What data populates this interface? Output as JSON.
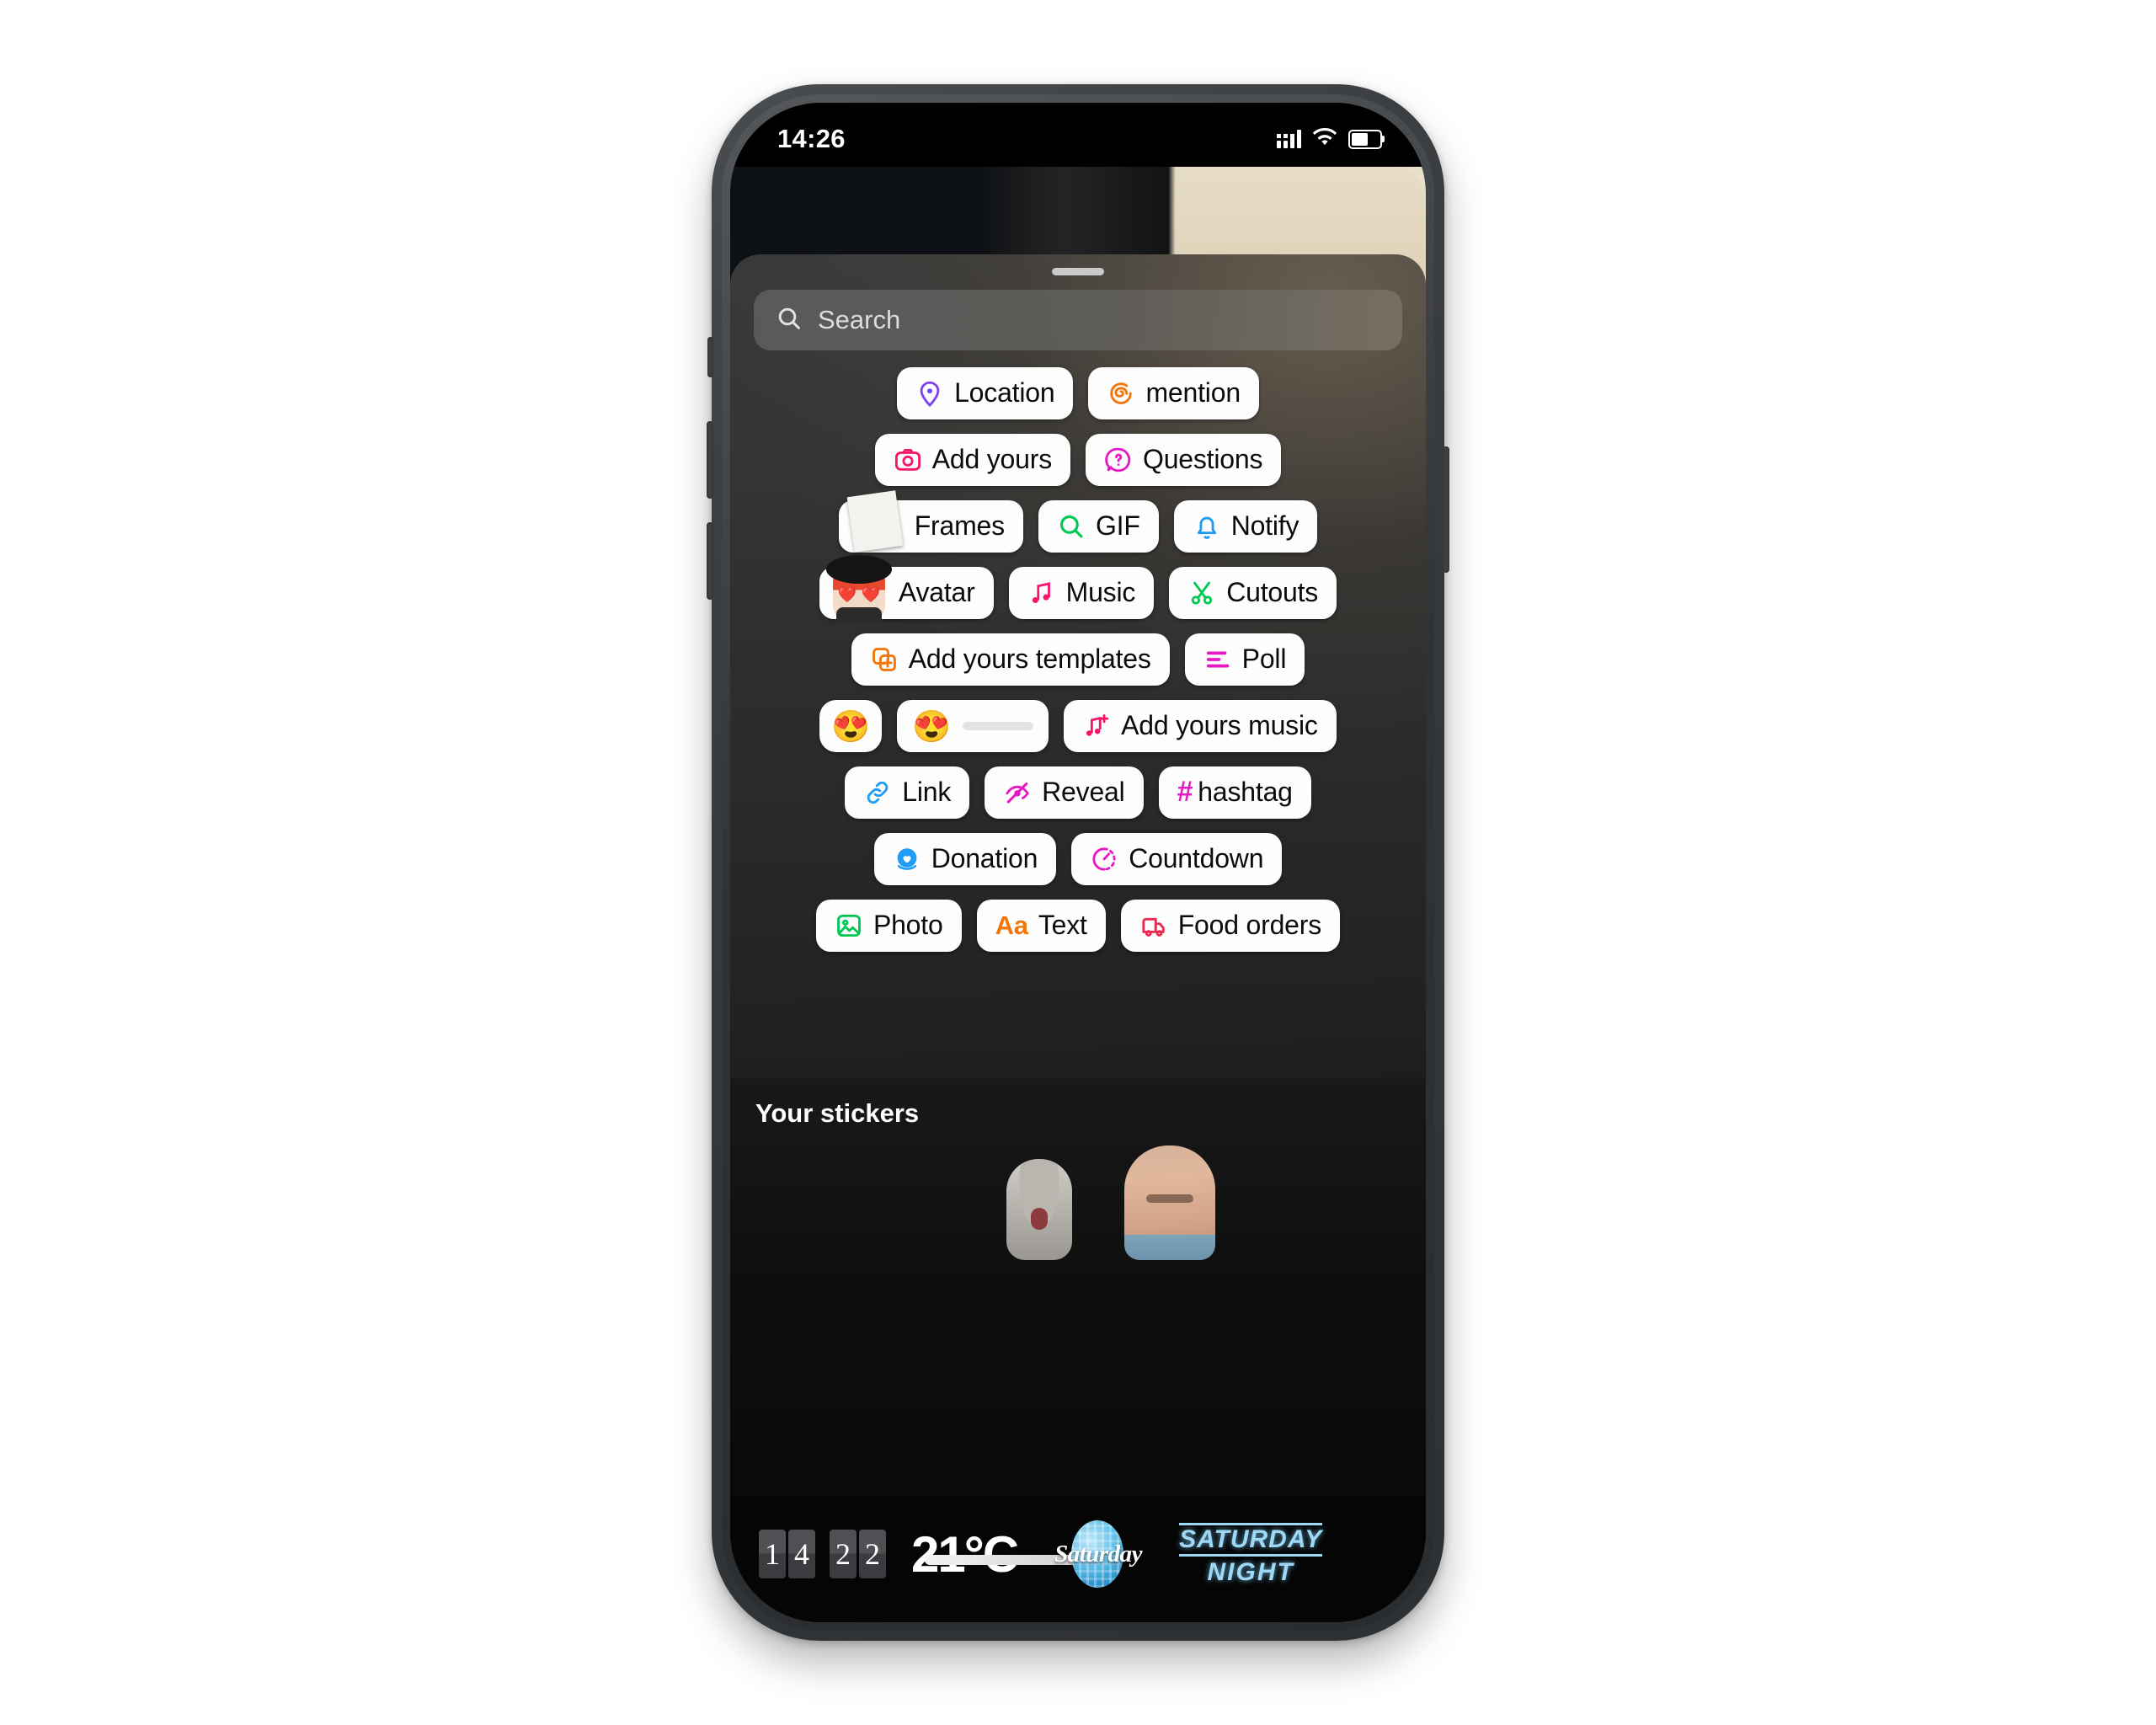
{
  "status_bar": {
    "time": "14:26",
    "signal_icon": "cellular-signal-icon",
    "wifi_icon": "wifi-icon",
    "battery_icon": "battery-icon"
  },
  "sheet": {
    "grabber": "sheet-drag-handle"
  },
  "search": {
    "placeholder": "Search",
    "value": "",
    "icon": "search-icon"
  },
  "stickers": {
    "rows": [
      [
        {
          "label": "Location",
          "icon": "location-pin-icon",
          "color": "#7b3ff2",
          "type": "pill"
        },
        {
          "label": "mention",
          "icon": "threads-at-icon",
          "color": "#f2770a",
          "type": "pill"
        }
      ],
      [
        {
          "label": "Add yours",
          "icon": "camera-icon",
          "color": "#f7156b",
          "type": "pill"
        },
        {
          "label": "Questions",
          "icon": "question-bubble-icon",
          "color": "#e619c4",
          "type": "pill"
        }
      ],
      [
        {
          "label": "Frames",
          "icon": "polaroid-photo-thumbnail",
          "color": "#ffffff",
          "type": "pill-thumb-frames"
        },
        {
          "label": "GIF",
          "icon": "magnifier-icon",
          "color": "#00c853",
          "type": "pill"
        },
        {
          "label": "Notify",
          "icon": "bell-icon",
          "color": "#1f9cf5",
          "type": "pill"
        }
      ],
      [
        {
          "label": "Avatar",
          "icon": "avatar-face-thumbnail",
          "color": "#ffffff",
          "type": "pill-thumb-avatar"
        },
        {
          "label": "Music",
          "icon": "music-note-icon",
          "color": "#f7156b",
          "type": "pill"
        },
        {
          "label": "Cutouts",
          "icon": "scissors-icon",
          "color": "#00c853",
          "type": "pill"
        }
      ],
      [
        {
          "label": "Add yours templates",
          "icon": "stacked-squares-plus-icon",
          "color": "#f2770a",
          "type": "pill"
        },
        {
          "label": "Poll",
          "icon": "poll-bars-icon",
          "color": "#e619c4",
          "type": "pill"
        }
      ],
      [
        {
          "label": "",
          "icon": "heart-eyes-emoji",
          "emoji": "😍",
          "type": "pill-emoji"
        },
        {
          "label": "",
          "icon": "emoji-slider",
          "emoji": "😍",
          "type": "pill-slider"
        },
        {
          "label": "Add yours music",
          "icon": "music-note-plus-icon",
          "color": "#f7156b",
          "type": "pill"
        }
      ],
      [
        {
          "label": "Link",
          "icon": "link-chain-icon",
          "color": "#1f9cf5",
          "type": "pill"
        },
        {
          "label": "Reveal",
          "icon": "eye-slash-icon",
          "color": "#e619c4",
          "type": "pill"
        },
        {
          "label": "hashtag",
          "icon": "hash-icon",
          "color": "#e619c4",
          "type": "pill-hash"
        }
      ],
      [
        {
          "label": "Donation",
          "icon": "donation-heart-icon",
          "color": "#1f9cf5",
          "type": "pill"
        },
        {
          "label": "Countdown",
          "icon": "countdown-timer-icon",
          "color": "#e619c4",
          "type": "pill"
        }
      ],
      [
        {
          "label": "Photo",
          "icon": "photo-image-icon",
          "color": "#00c853",
          "type": "pill"
        },
        {
          "label": "Text",
          "icon": "text-aa-icon",
          "color": "#f2770a",
          "type": "pill-aa"
        },
        {
          "label": "Food orders",
          "icon": "food-delivery-icon",
          "color": "#f0274e",
          "type": "pill"
        }
      ]
    ]
  },
  "your_stickers": {
    "title": "Your stickers",
    "items": [
      {
        "name": "cat-sticker"
      },
      {
        "name": "man-face-sticker"
      }
    ]
  },
  "bottom_stickers": {
    "flip_clock": {
      "hours": "14",
      "minutes": "22"
    },
    "temperature": "21°C",
    "day_sticker": "Saturday",
    "neon_sticker": {
      "line1": "SATURDAY",
      "line2": "NIGHT"
    }
  }
}
